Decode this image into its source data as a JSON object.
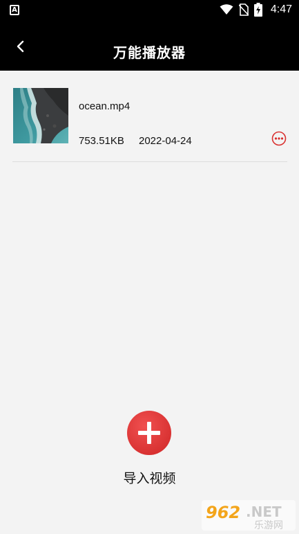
{
  "status_bar": {
    "app_icon_letter": "A",
    "time": "4:47"
  },
  "header": {
    "title": "万能播放器",
    "back_icon": "chevron-left-icon"
  },
  "videos": [
    {
      "name": "ocean.mp4",
      "size": "753.51KB",
      "date": "2022-04-24",
      "more_icon": "more-horizontal-icon"
    }
  ],
  "import_button": {
    "label": "导入视频",
    "icon": "plus-icon",
    "color": "#e33a3a"
  },
  "watermark": {
    "brand_number": "962",
    "brand_suffix": ".NET",
    "brand_name": "乐游网"
  },
  "colors": {
    "header_bg": "#000000",
    "page_bg": "#f3f3f3",
    "accent": "#d9302f"
  }
}
